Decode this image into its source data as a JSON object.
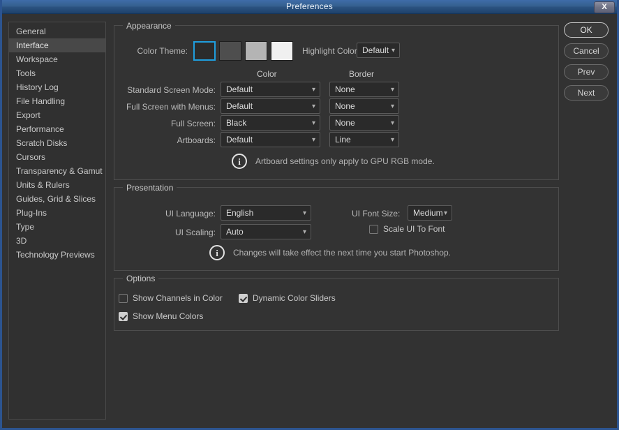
{
  "window": {
    "title": "Preferences",
    "close_label": "X"
  },
  "sidebar": {
    "items": [
      {
        "label": "General",
        "selected": false
      },
      {
        "label": "Interface",
        "selected": true
      },
      {
        "label": "Workspace",
        "selected": false
      },
      {
        "label": "Tools",
        "selected": false
      },
      {
        "label": "History Log",
        "selected": false
      },
      {
        "label": "File Handling",
        "selected": false
      },
      {
        "label": "Export",
        "selected": false
      },
      {
        "label": "Performance",
        "selected": false
      },
      {
        "label": "Scratch Disks",
        "selected": false
      },
      {
        "label": "Cursors",
        "selected": false
      },
      {
        "label": "Transparency & Gamut",
        "selected": false
      },
      {
        "label": "Units & Rulers",
        "selected": false
      },
      {
        "label": "Guides, Grid & Slices",
        "selected": false
      },
      {
        "label": "Plug-Ins",
        "selected": false
      },
      {
        "label": "Type",
        "selected": false
      },
      {
        "label": "3D",
        "selected": false
      },
      {
        "label": "Technology Previews",
        "selected": false
      }
    ]
  },
  "buttons": [
    {
      "label": "OK",
      "default": true
    },
    {
      "label": "Cancel",
      "default": false
    },
    {
      "label": "Prev",
      "default": false
    },
    {
      "label": "Next",
      "default": false
    }
  ],
  "appearance": {
    "legend": "Appearance",
    "color_theme_label": "Color Theme:",
    "swatches": [
      {
        "name": "dark",
        "color": "#2b2b2b",
        "selected": true
      },
      {
        "name": "medium-dark",
        "color": "#4e4e4e",
        "selected": false
      },
      {
        "name": "light-gray",
        "color": "#b4b4b4",
        "selected": false
      },
      {
        "name": "light",
        "color": "#f0f0f0",
        "selected": false
      }
    ],
    "selection_color": "#1f9ede",
    "highlight_color_label": "Highlight Color:",
    "highlight_color_value": "Default",
    "col_header_color": "Color",
    "col_header_border": "Border",
    "rows": [
      {
        "label": "Standard Screen Mode:",
        "color": "Default",
        "border": "None"
      },
      {
        "label": "Full Screen with Menus:",
        "color": "Default",
        "border": "None"
      },
      {
        "label": "Full Screen:",
        "color": "Black",
        "border": "None"
      },
      {
        "label": "Artboards:",
        "color": "Default",
        "border": "Line"
      }
    ],
    "note": "Artboard settings only apply to GPU RGB mode.",
    "note_icon": "i"
  },
  "presentation": {
    "legend": "Presentation",
    "ui_language_label": "UI Language:",
    "ui_language_value": "English",
    "ui_scaling_label": "UI Scaling:",
    "ui_scaling_value": "Auto",
    "ui_font_size_label": "UI Font Size:",
    "ui_font_size_value": "Medium",
    "scale_ui_to_font_label": "Scale UI To Font",
    "scale_ui_to_font_checked": false,
    "note": "Changes will take effect the next time you start Photoshop.",
    "note_icon": "i"
  },
  "options": {
    "legend": "Options",
    "items": [
      {
        "label": "Show Channels in Color",
        "checked": false
      },
      {
        "label": "Dynamic Color Sliders",
        "checked": true
      },
      {
        "label": "Show Menu Colors",
        "checked": true
      }
    ]
  }
}
